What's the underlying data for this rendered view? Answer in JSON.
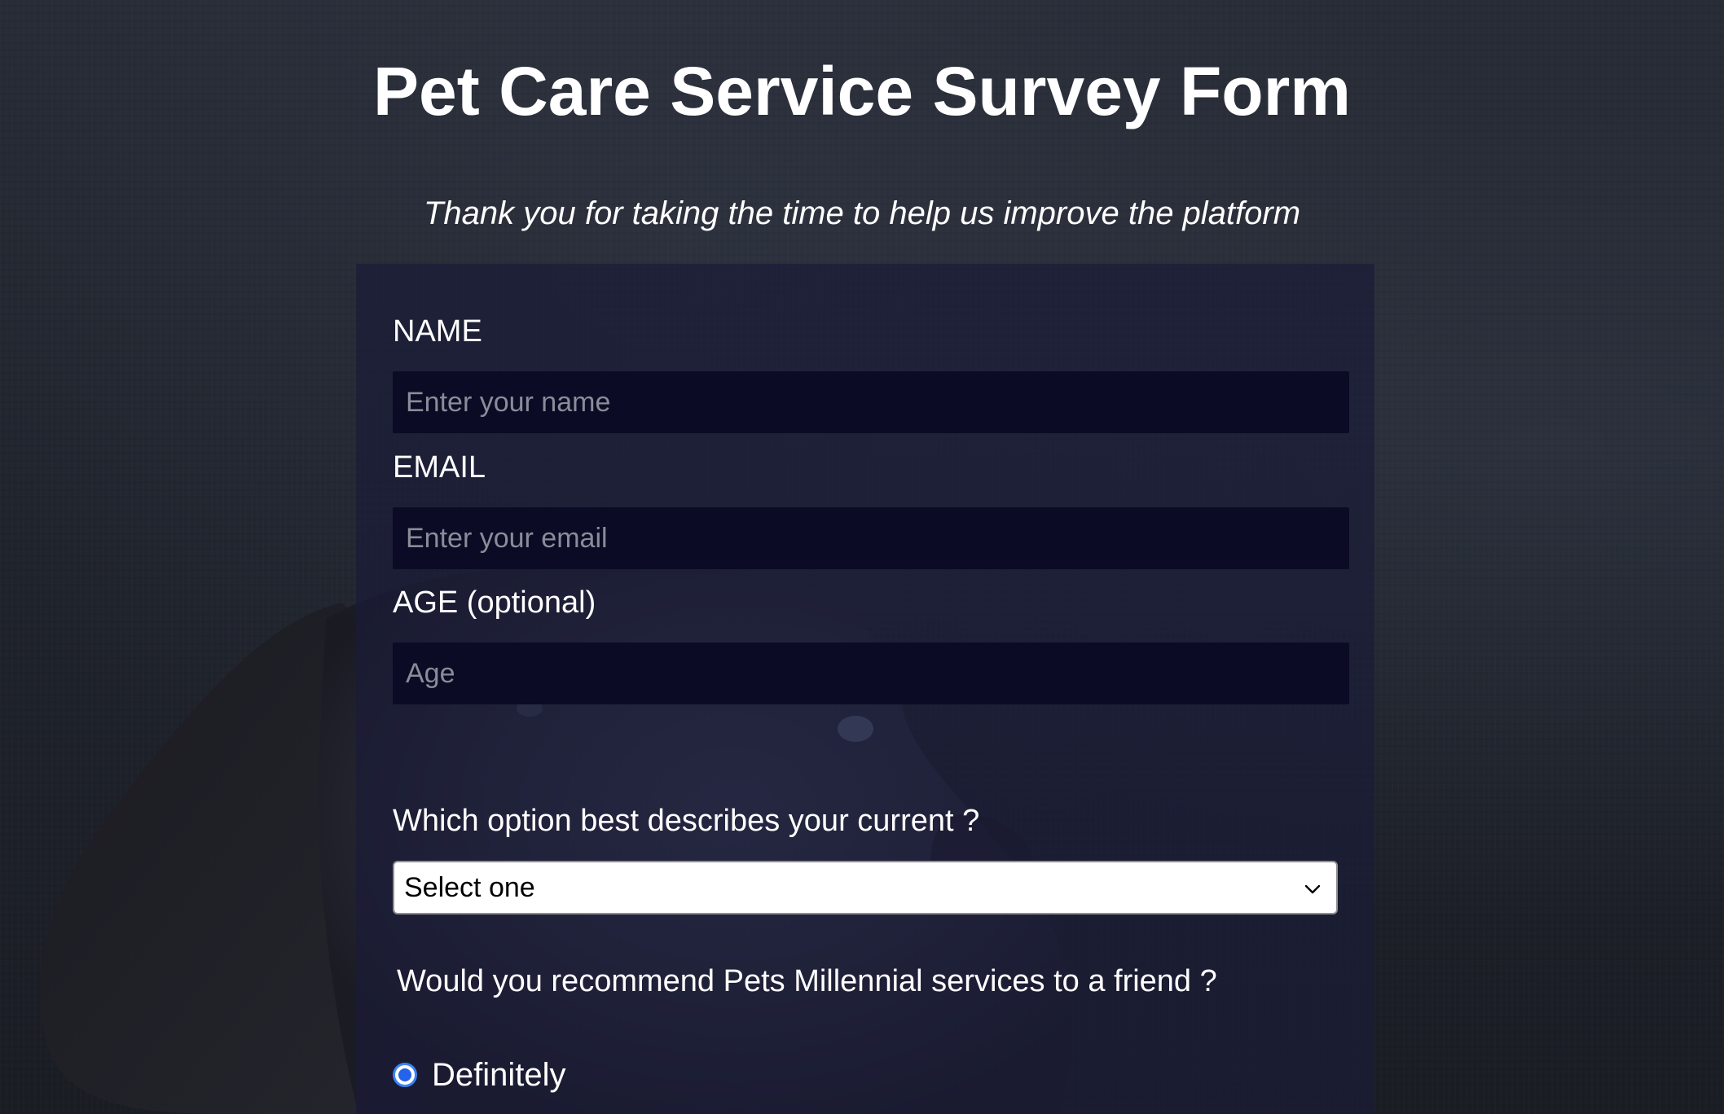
{
  "page": {
    "title": "Pet Care Service Survey Form",
    "description": "Thank you for taking the time to help us improve the platform"
  },
  "form": {
    "name": {
      "label": "NAME",
      "placeholder": "Enter your name",
      "value": ""
    },
    "email": {
      "label": "EMAIL",
      "placeholder": "Enter your email",
      "value": ""
    },
    "age": {
      "label": "AGE (optional)",
      "placeholder": "Age",
      "value": ""
    },
    "current_role": {
      "question": "Which option best describes your current ?",
      "selected": "Select one"
    },
    "recommend": {
      "question": "Would you recommend Pets Millennial services to a friend ?",
      "options": [
        {
          "label": "Definitely",
          "checked": true
        }
      ]
    }
  },
  "theme": {
    "background": "#23262f",
    "panel": "#1b1c38",
    "input_background": "#0b0b25",
    "radio_accent": "#2563eb"
  },
  "icons": {
    "select_arrow": "chevron-down-icon"
  }
}
